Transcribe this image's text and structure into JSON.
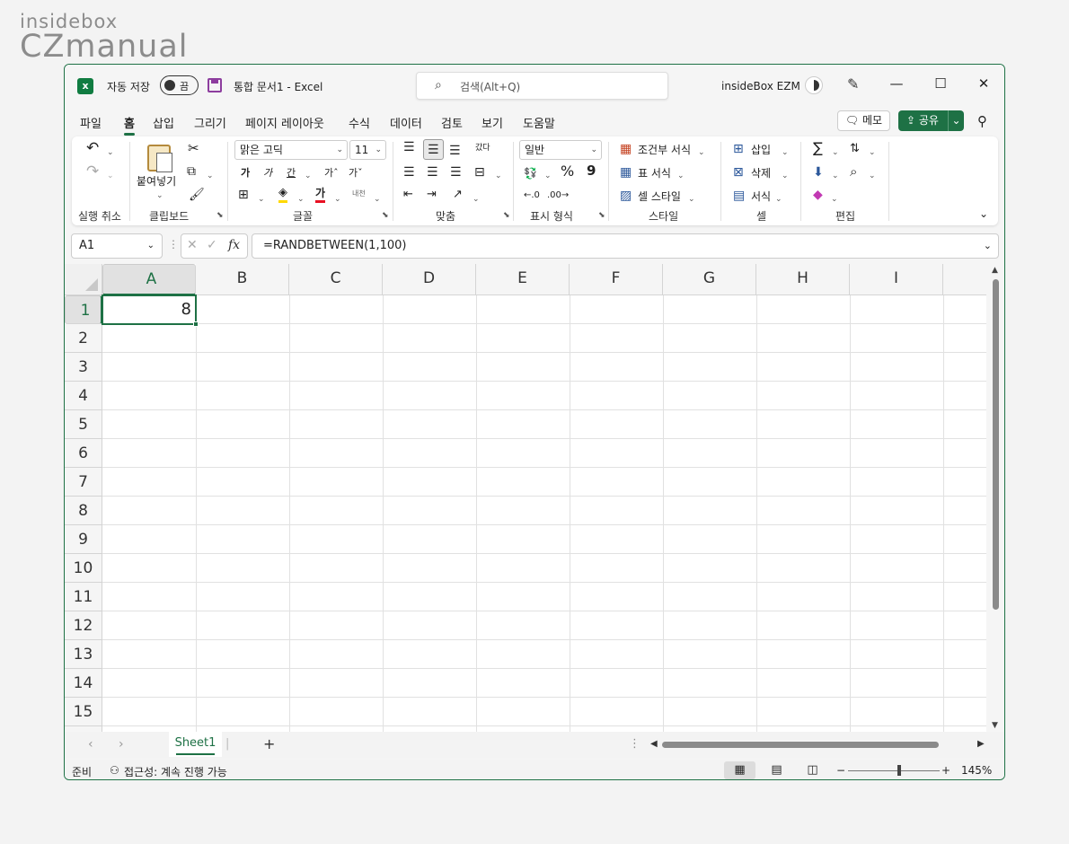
{
  "watermark": {
    "line1": "insidebox",
    "line2": "CZmanual"
  },
  "titlebar": {
    "autosave_label": "자동 저장",
    "autosave_state": "끔",
    "document_title": "통합 문서1  -  Excel",
    "search_placeholder": "검색(Alt+Q)",
    "user_name": "insideBox EZM",
    "minimize": "—",
    "maximize": "☐",
    "close": "✕"
  },
  "ribbon_tabs": [
    "파일",
    "홈",
    "삽입",
    "그리기",
    "페이지 레이아웃",
    "수식",
    "데이터",
    "검토",
    "보기",
    "도움말"
  ],
  "active_tab": "홈",
  "memo_button": "메모",
  "share_button": "공유",
  "ribbon": {
    "undo_group": "실행 취소",
    "clipboard": {
      "label": "클립보드",
      "paste": "붙여넣기"
    },
    "font": {
      "label": "글꼴",
      "font_name": "맑은 고딕",
      "font_size": "11",
      "bold": "가",
      "italic": "가",
      "underline": "간",
      "grow": "가ˆ",
      "shrink": "가ˇ",
      "highlight_color": "#ffd800",
      "font_color": "#e81123",
      "font_color_glyph": "가",
      "phonetic": "내천"
    },
    "alignment": {
      "label": "맞춤",
      "wrap": "갔다"
    },
    "number": {
      "label": "표시 형식",
      "format": "일반",
      "percent": "%",
      "comma": "9"
    },
    "styles": {
      "label": "스타일",
      "conditional": "조건부 서식",
      "table": "표 서식",
      "cell_styles": "셀 스타일"
    },
    "cells": {
      "label": "셀",
      "insert": "삽입",
      "delete": "삭제",
      "format": "서식"
    },
    "editing": {
      "label": "편집",
      "sum": "∑"
    }
  },
  "formula_bar": {
    "name_box": "A1",
    "formula": "=RANDBETWEEN(1,100)",
    "fx": "fx"
  },
  "grid": {
    "columns": [
      "A",
      "B",
      "C",
      "D",
      "E",
      "F",
      "G",
      "H",
      "I"
    ],
    "rows": [
      "1",
      "2",
      "3",
      "4",
      "5",
      "6",
      "7",
      "8",
      "9",
      "10",
      "11",
      "12",
      "13",
      "14",
      "15"
    ],
    "selected_column": "A",
    "selected_row": "1",
    "active_cell_value": "8"
  },
  "sheets": {
    "tabs": [
      "Sheet1"
    ],
    "add": "+"
  },
  "status": {
    "mode": "준비",
    "accessibility": "접근성: 계속 진행 가능",
    "zoom_minus": "−",
    "zoom_plus": "+",
    "zoom": "145%"
  },
  "accent_color": "#1e7145"
}
